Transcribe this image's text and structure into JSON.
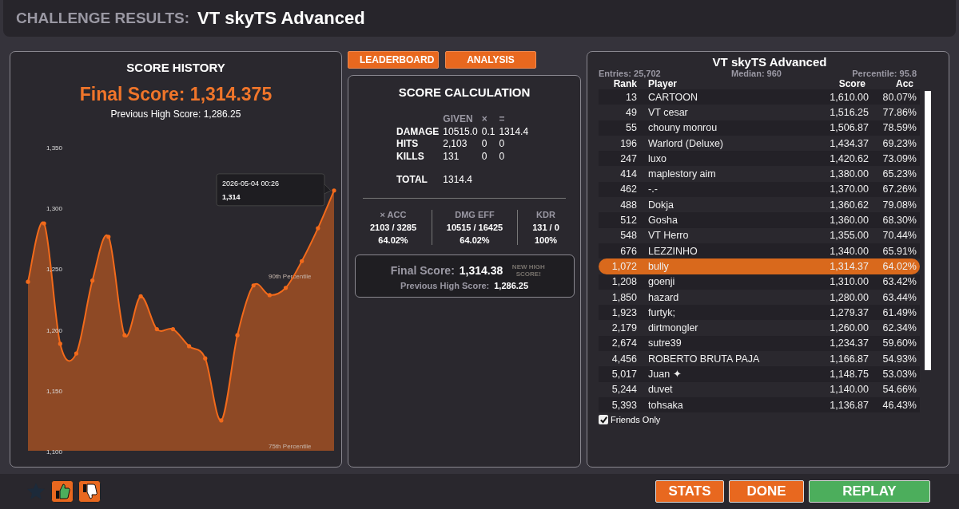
{
  "header": {
    "label": "CHALLENGE RESULTS:",
    "title": "VT skyTS Advanced"
  },
  "score_history": {
    "title": "SCORE HISTORY",
    "final_score": "Final Score: 1,314.375",
    "previous_high": "Previous High Score: 1,286.25",
    "tooltip": {
      "date": "2026-05-04 00:26",
      "value": "1,314"
    },
    "chart_data": {
      "series": [
        {
          "color": "#f26a1b",
          "values": [
            1239,
            1287,
            1188,
            1180,
            1240,
            1276,
            1195,
            1227,
            1200,
            1200,
            1186,
            1176,
            1125,
            1195,
            1236,
            1228,
            1234,
            1256,
            1283,
            1314
          ]
        }
      ],
      "ylim": [
        1100,
        1350
      ],
      "yticks": [
        {
          "value": 1100,
          "label": "1,100"
        },
        {
          "value": 1150,
          "label": "1,150"
        },
        {
          "value": 1200,
          "label": "1,200"
        },
        {
          "value": 1250,
          "label": "1,250"
        },
        {
          "value": 1300,
          "label": "1,300"
        },
        {
          "value": 1350,
          "label": "1,350"
        }
      ],
      "type": "area"
    },
    "percentile_labels": [
      "90th Percentile",
      "75th Percentile"
    ]
  },
  "tabs": [
    {
      "label": "LEADERBOARD"
    },
    {
      "label": "ANALYSIS"
    }
  ],
  "score_calculation": {
    "title": "SCORE CALCULATION",
    "columns": [
      "GIVEN",
      "×",
      "="
    ],
    "rows": [
      {
        "label": "DAMAGE",
        "given": "10515.0",
        "multiplier": "0.1",
        "result": "1314.4"
      },
      {
        "label": "HITS",
        "given": "2,103",
        "multiplier": "0",
        "result": "0"
      },
      {
        "label": "KILLS",
        "given": "131",
        "multiplier": "0",
        "result": "0"
      }
    ],
    "total": {
      "label": "TOTAL",
      "value": "1314.4"
    },
    "stats": [
      {
        "label": "× ACC",
        "ratio": "2103 / 3285",
        "percent": "64.02%"
      },
      {
        "label": "DMG EFF",
        "ratio": "10515 / 16425",
        "percent": "64.02%"
      },
      {
        "label": "KDR",
        "ratio": "131 / 0",
        "percent": "100%"
      }
    ],
    "final": {
      "label": "Final Score:",
      "value": "1,314.38",
      "new_high": "NEW HIGH SCORE!",
      "new_high_active": false,
      "previous_label": "Previous High Score:",
      "previous_value": "1,286.25"
    }
  },
  "leaderboard": {
    "title": "VT skyTS Advanced",
    "entries": "Entries: 25,702",
    "median": "Median: 960",
    "percentile": "Percentile: 95.8",
    "columns": [
      "Rank",
      "Player",
      "Score",
      "Acc"
    ],
    "rows": [
      {
        "rank": "13",
        "player": "CARTOON",
        "score": "1,610.00",
        "acc": "80.07%",
        "selected": false
      },
      {
        "rank": "49",
        "player": "VT cesar",
        "score": "1,516.25",
        "acc": "77.86%",
        "selected": false
      },
      {
        "rank": "55",
        "player": "chouny monrou",
        "score": "1,506.87",
        "acc": "78.59%",
        "selected": false
      },
      {
        "rank": "196",
        "player": "Warlord (Deluxe)",
        "score": "1,434.37",
        "acc": "69.23%",
        "selected": false
      },
      {
        "rank": "247",
        "player": "luxo",
        "score": "1,420.62",
        "acc": "73.09%",
        "selected": false
      },
      {
        "rank": "414",
        "player": "maplestory aim",
        "score": "1,380.00",
        "acc": "65.23%",
        "selected": false
      },
      {
        "rank": "462",
        "player": "-.-",
        "score": "1,370.00",
        "acc": "67.26%",
        "selected": false
      },
      {
        "rank": "488",
        "player": "Dokja",
        "score": "1,360.62",
        "acc": "79.08%",
        "selected": false
      },
      {
        "rank": "512",
        "player": "Gosha",
        "score": "1,360.00",
        "acc": "68.30%",
        "selected": false
      },
      {
        "rank": "548",
        "player": "VT Herro",
        "score": "1,355.00",
        "acc": "70.44%",
        "selected": false
      },
      {
        "rank": "676",
        "player": "LEZZINHO",
        "score": "1,340.00",
        "acc": "65.91%",
        "selected": false
      },
      {
        "rank": "1,072",
        "player": "bully",
        "score": "1,314.37",
        "acc": "64.02%",
        "selected": true
      },
      {
        "rank": "1,208",
        "player": "goenji",
        "score": "1,310.00",
        "acc": "63.42%",
        "selected": false
      },
      {
        "rank": "1,850",
        "player": "hazard",
        "score": "1,280.00",
        "acc": "63.44%",
        "selected": false
      },
      {
        "rank": "1,923",
        "player": "furtyk;",
        "score": "1,279.37",
        "acc": "61.49%",
        "selected": false
      },
      {
        "rank": "2,179",
        "player": "dirtmongler",
        "score": "1,260.00",
        "acc": "62.34%",
        "selected": false
      },
      {
        "rank": "2,674",
        "player": "sutre39",
        "score": "1,234.37",
        "acc": "59.60%",
        "selected": false
      },
      {
        "rank": "4,456",
        "player": "ROBERTO BRUTA PAJA",
        "score": "1,166.87",
        "acc": "54.93%",
        "selected": false
      },
      {
        "rank": "5,017",
        "player": "Juan ✦",
        "score": "1,148.75",
        "acc": "53.03%",
        "selected": false
      },
      {
        "rank": "5,244",
        "player": "duvet",
        "score": "1,140.00",
        "acc": "54.66%",
        "selected": false
      },
      {
        "rank": "5,393",
        "player": "tohsaka",
        "score": "1,136.87",
        "acc": "46.43%",
        "selected": false
      }
    ],
    "friends_only": {
      "label": "Friends Only",
      "checked": true
    }
  },
  "footer": {
    "buttons": [
      {
        "label": "STATS",
        "kind": "secondary"
      },
      {
        "label": "DONE",
        "kind": "secondary"
      },
      {
        "label": "REPLAY",
        "kind": "primary"
      }
    ]
  }
}
